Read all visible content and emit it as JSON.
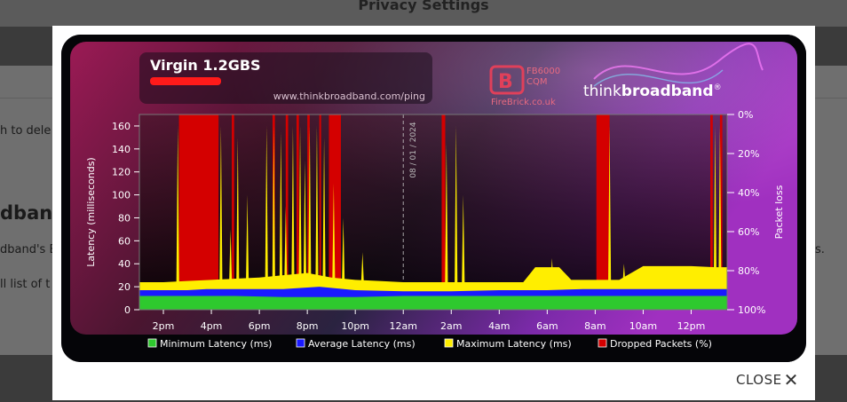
{
  "background": {
    "title": "Privacy Settings",
    "frag_delete": "h to dele",
    "frag_heading": "dband",
    "frag_text": "dband's E",
    "frag_link": "ll list",
    "frag_of": " of t",
    "frag_right": "s."
  },
  "modal": {
    "close_label": "CLOSE",
    "close_icon": "close-x-icon"
  },
  "chart_data": {
    "type": "area",
    "title": "Virgin 1.2GBS",
    "subtitle_redacted": true,
    "url": "www.thinkbroadband.com/ping",
    "logo_firebrick": {
      "line1": "FB6000",
      "line2": "CQM",
      "site": "FireBrick.co.uk"
    },
    "logo_tbb": {
      "think": "think",
      "broadband": "broadband",
      "reg": "®"
    },
    "date_marker": "08 / 01 / 2024",
    "date_marker_x": 24,
    "ylabel": "Latency (milliseconds)",
    "ylabel_right": "Packet loss",
    "ylim": [
      0,
      170
    ],
    "yticks": [
      0,
      20,
      40,
      60,
      80,
      100,
      120,
      140,
      160
    ],
    "y2ticks": [
      "0%",
      "20%",
      "40%",
      "60%",
      "80%",
      "100%"
    ],
    "xlim": [
      13,
      37.5
    ],
    "xticks": [
      {
        "x": 14,
        "label": "2pm"
      },
      {
        "x": 16,
        "label": "4pm"
      },
      {
        "x": 18,
        "label": "6pm"
      },
      {
        "x": 20,
        "label": "8pm"
      },
      {
        "x": 22,
        "label": "10pm"
      },
      {
        "x": 24,
        "label": "12am"
      },
      {
        "x": 26,
        "label": "2am"
      },
      {
        "x": 28,
        "label": "4am"
      },
      {
        "x": 30,
        "label": "6am"
      },
      {
        "x": 32,
        "label": "8am"
      },
      {
        "x": 34,
        "label": "10am"
      },
      {
        "x": 36,
        "label": "12pm"
      }
    ],
    "legend": [
      {
        "name": "Minimum Latency (ms)",
        "color": "#2ec92e"
      },
      {
        "name": "Average Latency (ms)",
        "color": "#1a1aff"
      },
      {
        "name": "Maximum Latency (ms)",
        "color": "#ffee00"
      },
      {
        "name": "Dropped Packets (%)",
        "color": "#d40000"
      }
    ],
    "series": [
      {
        "name": "Minimum Latency (ms)",
        "x": [
          13,
          15,
          15.8,
          17,
          19,
          20.5,
          22,
          24,
          26,
          28,
          30,
          31.5,
          34,
          36,
          37.5
        ],
        "values": [
          12,
          12,
          12,
          12,
          11,
          11,
          11,
          12,
          12,
          12,
          12,
          12,
          12,
          12,
          12
        ]
      },
      {
        "name": "Average Latency (ms)",
        "x": [
          13,
          15,
          15.8,
          17,
          19,
          20.5,
          22,
          24,
          26,
          28,
          30,
          31.5,
          34,
          36,
          37.5
        ],
        "values": [
          17,
          17,
          18,
          18,
          18,
          20,
          17,
          16,
          16,
          17,
          17,
          18,
          18,
          18,
          18
        ]
      },
      {
        "name": "Maximum Latency (ms)",
        "x": [
          13,
          14,
          15,
          16,
          17,
          18,
          19,
          20,
          21,
          22,
          23,
          24,
          25,
          26,
          27,
          28,
          29,
          29.5,
          30.5,
          31,
          32,
          33,
          34,
          35,
          36,
          37,
          37.5
        ],
        "values": [
          24,
          24,
          25,
          26,
          27,
          28,
          30,
          32,
          28,
          26,
          25,
          24,
          24,
          24,
          24,
          24,
          24,
          37,
          37,
          26,
          26,
          26,
          38,
          38,
          38,
          37,
          37
        ]
      }
    ],
    "spikes": [
      {
        "x": 14.6,
        "v": 160
      },
      {
        "x": 16.4,
        "v": 160
      },
      {
        "x": 16.8,
        "v": 70
      },
      {
        "x": 17.1,
        "v": 150
      },
      {
        "x": 17.5,
        "v": 100
      },
      {
        "x": 18.3,
        "v": 160
      },
      {
        "x": 18.6,
        "v": 160
      },
      {
        "x": 18.9,
        "v": 155
      },
      {
        "x": 19.1,
        "v": 90
      },
      {
        "x": 19.4,
        "v": 160
      },
      {
        "x": 19.7,
        "v": 160
      },
      {
        "x": 19.9,
        "v": 130
      },
      {
        "x": 20.1,
        "v": 160
      },
      {
        "x": 20.4,
        "v": 160
      },
      {
        "x": 20.7,
        "v": 150
      },
      {
        "x": 21.1,
        "v": 110
      },
      {
        "x": 21.5,
        "v": 80
      },
      {
        "x": 22.3,
        "v": 50
      },
      {
        "x": 25.8,
        "v": 145
      },
      {
        "x": 26.2,
        "v": 160
      },
      {
        "x": 26.5,
        "v": 100
      },
      {
        "x": 30.2,
        "v": 45
      },
      {
        "x": 32.6,
        "v": 160
      },
      {
        "x": 33.2,
        "v": 40
      },
      {
        "x": 37.0,
        "v": 160
      },
      {
        "x": 37.2,
        "v": 160
      }
    ],
    "dropped_packets": [
      {
        "x0": 14.65,
        "x1": 16.3
      },
      {
        "x0": 16.85,
        "x1": 16.95
      },
      {
        "x0": 18.55,
        "x1": 18.65
      },
      {
        "x0": 19.1,
        "x1": 19.2
      },
      {
        "x0": 19.55,
        "x1": 19.65
      },
      {
        "x0": 20.0,
        "x1": 20.1
      },
      {
        "x0": 20.5,
        "x1": 20.55
      },
      {
        "x0": 20.9,
        "x1": 21.4
      },
      {
        "x0": 25.6,
        "x1": 25.75
      },
      {
        "x0": 32.05,
        "x1": 32.6
      },
      {
        "x0": 36.8,
        "x1": 36.9
      },
      {
        "x0": 37.2,
        "x1": 37.3
      }
    ]
  }
}
